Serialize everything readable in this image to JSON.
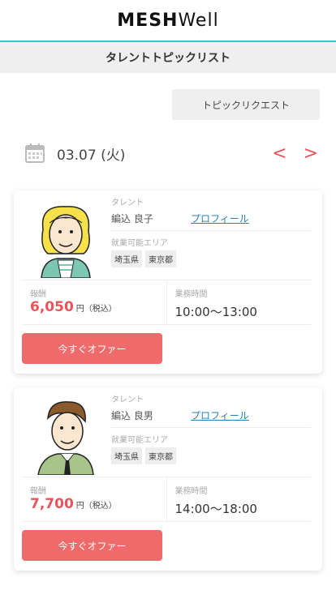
{
  "header": {
    "logo_bold": "MESH",
    "logo_light": "Well"
  },
  "subheader": {
    "title": "タレントトピックリスト"
  },
  "request_button": "トピックリクエスト",
  "datebar": {
    "date": "03.07 (火)",
    "prev": "<",
    "next": ">"
  },
  "talents": [
    {
      "talent_label": "タレント",
      "name": "編込 良子",
      "profile_link": "プロフィール",
      "area_label": "就業可能エリア",
      "areas": [
        "埼玉県",
        "東京都"
      ],
      "fee_label": "報酬",
      "fee": "6,050",
      "fee_unit": "円（税込）",
      "time_label": "業務時間",
      "time": "10:00～13:00",
      "offer_button": "今すぐオファー"
    },
    {
      "talent_label": "タレント",
      "name": "編込 良男",
      "profile_link": "プロフィール",
      "area_label": "就業可能エリア",
      "areas": [
        "埼玉県",
        "東京都"
      ],
      "fee_label": "報酬",
      "fee": "7,700",
      "fee_unit": "円（税込）",
      "time_label": "業務時間",
      "time": "14:00～18:00",
      "offer_button": "今すぐオファー"
    }
  ],
  "icons": {
    "calendar": "calendar-icon"
  },
  "colors": {
    "accent": "#39c3cf",
    "price": "#e8545a",
    "offer": "#ef6b6b",
    "link": "#2a7fb5"
  }
}
